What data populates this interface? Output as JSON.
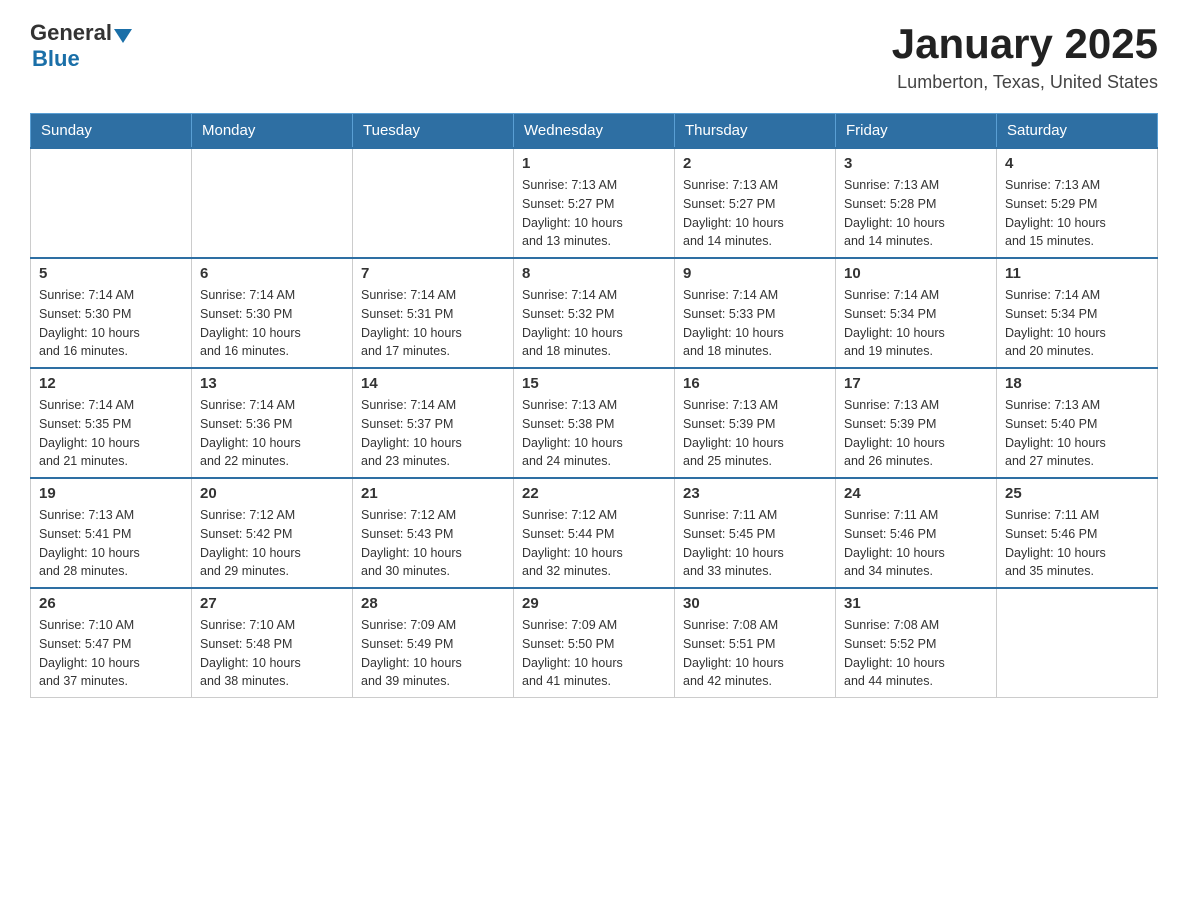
{
  "header": {
    "logo_general": "General",
    "logo_blue": "Blue",
    "month_title": "January 2025",
    "location": "Lumberton, Texas, United States"
  },
  "days_of_week": [
    "Sunday",
    "Monday",
    "Tuesday",
    "Wednesday",
    "Thursday",
    "Friday",
    "Saturday"
  ],
  "weeks": [
    [
      {
        "day": "",
        "info": ""
      },
      {
        "day": "",
        "info": ""
      },
      {
        "day": "",
        "info": ""
      },
      {
        "day": "1",
        "info": "Sunrise: 7:13 AM\nSunset: 5:27 PM\nDaylight: 10 hours\nand 13 minutes."
      },
      {
        "day": "2",
        "info": "Sunrise: 7:13 AM\nSunset: 5:27 PM\nDaylight: 10 hours\nand 14 minutes."
      },
      {
        "day": "3",
        "info": "Sunrise: 7:13 AM\nSunset: 5:28 PM\nDaylight: 10 hours\nand 14 minutes."
      },
      {
        "day": "4",
        "info": "Sunrise: 7:13 AM\nSunset: 5:29 PM\nDaylight: 10 hours\nand 15 minutes."
      }
    ],
    [
      {
        "day": "5",
        "info": "Sunrise: 7:14 AM\nSunset: 5:30 PM\nDaylight: 10 hours\nand 16 minutes."
      },
      {
        "day": "6",
        "info": "Sunrise: 7:14 AM\nSunset: 5:30 PM\nDaylight: 10 hours\nand 16 minutes."
      },
      {
        "day": "7",
        "info": "Sunrise: 7:14 AM\nSunset: 5:31 PM\nDaylight: 10 hours\nand 17 minutes."
      },
      {
        "day": "8",
        "info": "Sunrise: 7:14 AM\nSunset: 5:32 PM\nDaylight: 10 hours\nand 18 minutes."
      },
      {
        "day": "9",
        "info": "Sunrise: 7:14 AM\nSunset: 5:33 PM\nDaylight: 10 hours\nand 18 minutes."
      },
      {
        "day": "10",
        "info": "Sunrise: 7:14 AM\nSunset: 5:34 PM\nDaylight: 10 hours\nand 19 minutes."
      },
      {
        "day": "11",
        "info": "Sunrise: 7:14 AM\nSunset: 5:34 PM\nDaylight: 10 hours\nand 20 minutes."
      }
    ],
    [
      {
        "day": "12",
        "info": "Sunrise: 7:14 AM\nSunset: 5:35 PM\nDaylight: 10 hours\nand 21 minutes."
      },
      {
        "day": "13",
        "info": "Sunrise: 7:14 AM\nSunset: 5:36 PM\nDaylight: 10 hours\nand 22 minutes."
      },
      {
        "day": "14",
        "info": "Sunrise: 7:14 AM\nSunset: 5:37 PM\nDaylight: 10 hours\nand 23 minutes."
      },
      {
        "day": "15",
        "info": "Sunrise: 7:13 AM\nSunset: 5:38 PM\nDaylight: 10 hours\nand 24 minutes."
      },
      {
        "day": "16",
        "info": "Sunrise: 7:13 AM\nSunset: 5:39 PM\nDaylight: 10 hours\nand 25 minutes."
      },
      {
        "day": "17",
        "info": "Sunrise: 7:13 AM\nSunset: 5:39 PM\nDaylight: 10 hours\nand 26 minutes."
      },
      {
        "day": "18",
        "info": "Sunrise: 7:13 AM\nSunset: 5:40 PM\nDaylight: 10 hours\nand 27 minutes."
      }
    ],
    [
      {
        "day": "19",
        "info": "Sunrise: 7:13 AM\nSunset: 5:41 PM\nDaylight: 10 hours\nand 28 minutes."
      },
      {
        "day": "20",
        "info": "Sunrise: 7:12 AM\nSunset: 5:42 PM\nDaylight: 10 hours\nand 29 minutes."
      },
      {
        "day": "21",
        "info": "Sunrise: 7:12 AM\nSunset: 5:43 PM\nDaylight: 10 hours\nand 30 minutes."
      },
      {
        "day": "22",
        "info": "Sunrise: 7:12 AM\nSunset: 5:44 PM\nDaylight: 10 hours\nand 32 minutes."
      },
      {
        "day": "23",
        "info": "Sunrise: 7:11 AM\nSunset: 5:45 PM\nDaylight: 10 hours\nand 33 minutes."
      },
      {
        "day": "24",
        "info": "Sunrise: 7:11 AM\nSunset: 5:46 PM\nDaylight: 10 hours\nand 34 minutes."
      },
      {
        "day": "25",
        "info": "Sunrise: 7:11 AM\nSunset: 5:46 PM\nDaylight: 10 hours\nand 35 minutes."
      }
    ],
    [
      {
        "day": "26",
        "info": "Sunrise: 7:10 AM\nSunset: 5:47 PM\nDaylight: 10 hours\nand 37 minutes."
      },
      {
        "day": "27",
        "info": "Sunrise: 7:10 AM\nSunset: 5:48 PM\nDaylight: 10 hours\nand 38 minutes."
      },
      {
        "day": "28",
        "info": "Sunrise: 7:09 AM\nSunset: 5:49 PM\nDaylight: 10 hours\nand 39 minutes."
      },
      {
        "day": "29",
        "info": "Sunrise: 7:09 AM\nSunset: 5:50 PM\nDaylight: 10 hours\nand 41 minutes."
      },
      {
        "day": "30",
        "info": "Sunrise: 7:08 AM\nSunset: 5:51 PM\nDaylight: 10 hours\nand 42 minutes."
      },
      {
        "day": "31",
        "info": "Sunrise: 7:08 AM\nSunset: 5:52 PM\nDaylight: 10 hours\nand 44 minutes."
      },
      {
        "day": "",
        "info": ""
      }
    ]
  ]
}
